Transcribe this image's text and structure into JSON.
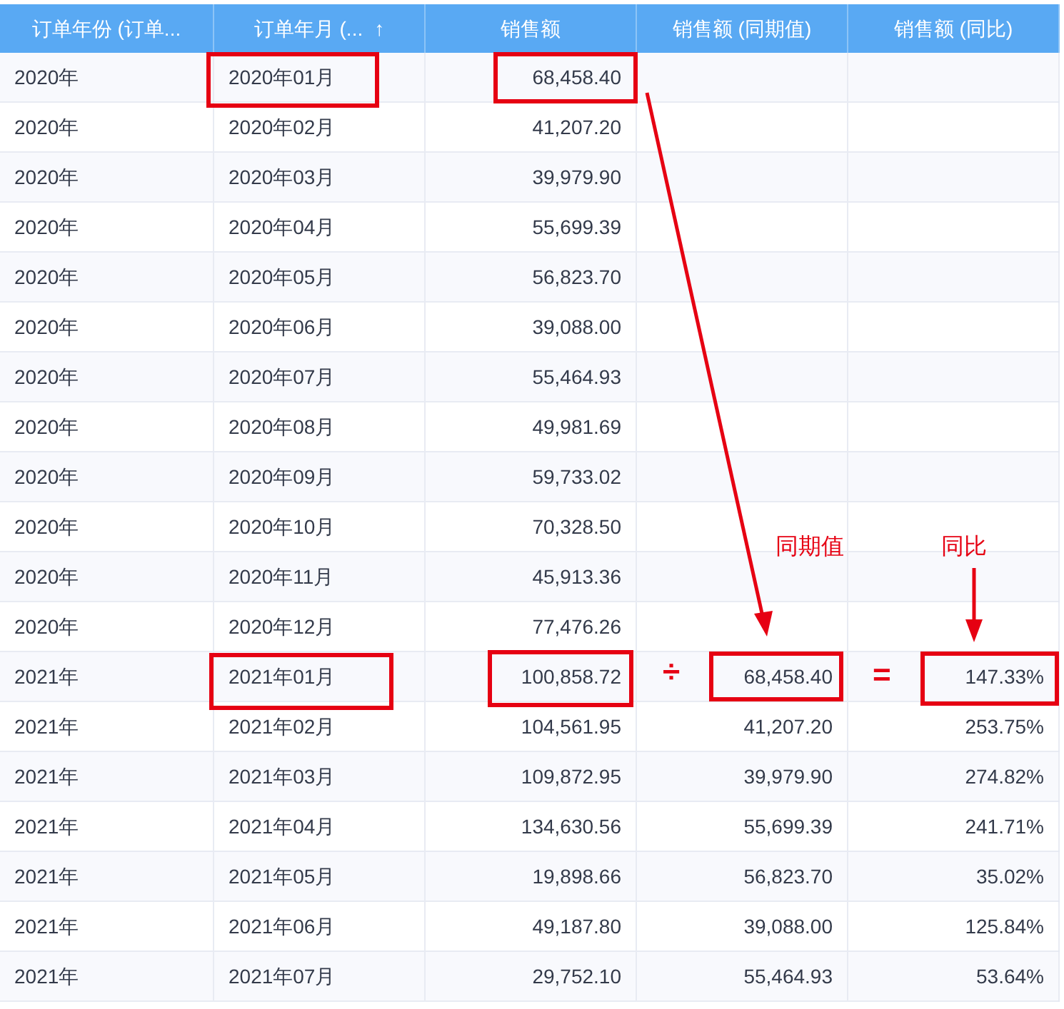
{
  "table": {
    "columns": [
      {
        "label": "订单年份 (订单..."
      },
      {
        "label": "订单年月 (...",
        "sort_indicator": "↑"
      },
      {
        "label": "销售额"
      },
      {
        "label": "销售额 (同期值)"
      },
      {
        "label": "销售额 (同比)"
      }
    ],
    "rows": [
      {
        "cells": [
          "2020年",
          "2020年01月",
          "68,458.40"
        ]
      },
      {
        "cells": [
          "2020年",
          "2020年02月",
          "41,207.20"
        ]
      },
      {
        "cells": [
          "2020年",
          "2020年03月",
          "39,979.90"
        ]
      },
      {
        "cells": [
          "2020年",
          "2020年04月",
          "55,699.39"
        ]
      },
      {
        "cells": [
          "2020年",
          "2020年05月",
          "56,823.70"
        ]
      },
      {
        "cells": [
          "2020年",
          "2020年06月",
          "39,088.00"
        ]
      },
      {
        "cells": [
          "2020年",
          "2020年07月",
          "55,464.93"
        ]
      },
      {
        "cells": [
          "2020年",
          "2020年08月",
          "49,981.69"
        ]
      },
      {
        "cells": [
          "2020年",
          "2020年09月",
          "59,733.02"
        ]
      },
      {
        "cells": [
          "2020年",
          "2020年10月",
          "70,328.50"
        ]
      },
      {
        "cells": [
          "2020年",
          "2020年11月",
          "45,913.36"
        ]
      },
      {
        "cells": [
          "2020年",
          "2020年12月",
          "77,476.26"
        ]
      },
      {
        "cells": [
          "2021年",
          "2021年01月",
          "100,858.72",
          "68,458.40",
          "147.33%"
        ]
      },
      {
        "cells": [
          "2021年",
          "2021年02月",
          "104,561.95",
          "41,207.20",
          "253.75%"
        ]
      },
      {
        "cells": [
          "2021年",
          "2021年03月",
          "109,872.95",
          "39,979.90",
          "274.82%"
        ]
      },
      {
        "cells": [
          "2021年",
          "2021年04月",
          "134,630.56",
          "55,699.39",
          "241.71%"
        ]
      },
      {
        "cells": [
          "2021年",
          "2021年05月",
          "19,898.66",
          "56,823.70",
          "35.02%"
        ]
      },
      {
        "cells": [
          "2021年",
          "2021年06月",
          "49,187.80",
          "39,088.00",
          "125.84%"
        ]
      },
      {
        "cells": [
          "2021年",
          "2021年07月",
          "29,752.10",
          "55,464.93",
          "53.64%"
        ]
      }
    ]
  },
  "annotations": {
    "labels": [
      "同期值",
      "同比"
    ],
    "operators": [
      "÷",
      "="
    ]
  }
}
